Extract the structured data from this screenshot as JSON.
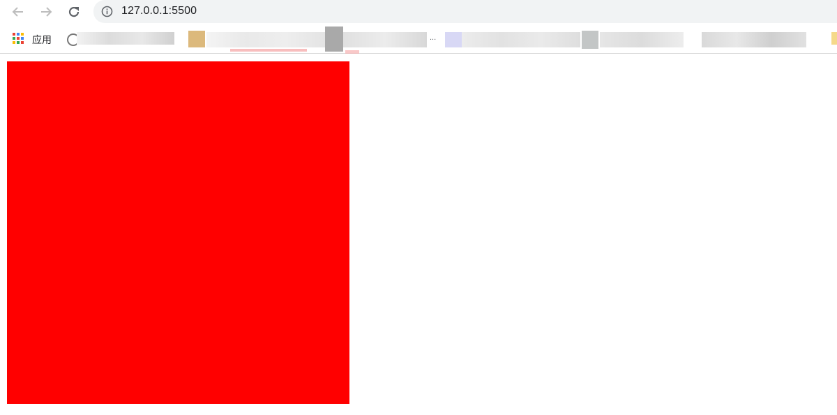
{
  "browser": {
    "url": "127.0.0.1:5500",
    "bookmarks_bar": {
      "apps_label": "应用",
      "overflow_label": "..."
    }
  },
  "content": {
    "box_color": "#ff0000"
  }
}
